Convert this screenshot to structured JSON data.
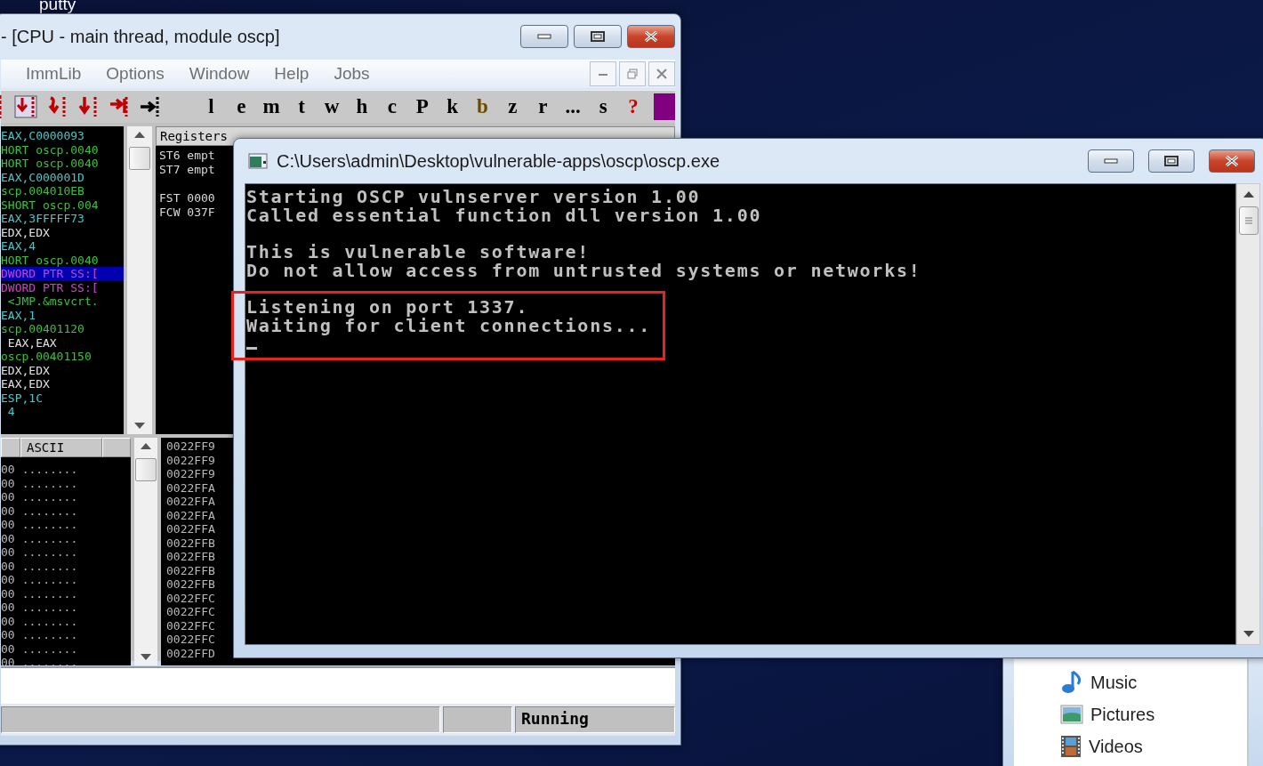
{
  "desktop": {
    "icon_label": "putty"
  },
  "debugger": {
    "title": "- [CPU - main thread, module oscp]",
    "menu": [
      "ImmLib",
      "Options",
      "Window",
      "Help",
      "Jobs"
    ],
    "toolbar": [
      {
        "label": "l",
        "color": "#000000"
      },
      {
        "label": "e",
        "color": "#000000"
      },
      {
        "label": "m",
        "color": "#000000"
      },
      {
        "label": "t",
        "color": "#000000"
      },
      {
        "label": "w",
        "color": "#000000"
      },
      {
        "label": "h",
        "color": "#000000"
      },
      {
        "label": "c",
        "color": "#000000"
      },
      {
        "label": "P",
        "color": "#000000"
      },
      {
        "label": "k",
        "color": "#000000"
      },
      {
        "label": "b",
        "color": "#6b4a00"
      },
      {
        "label": "z",
        "color": "#000000"
      },
      {
        "label": "r",
        "color": "#000000"
      },
      {
        "label": "...",
        "color": "#000000"
      },
      {
        "label": "s",
        "color": "#000000"
      },
      {
        "label": "?",
        "color": "#cc0000"
      }
    ],
    "disassembly": [
      {
        "text": "EAX,C0000093",
        "kind": "value",
        "selected": false
      },
      {
        "text": "HORT oscp.0040",
        "kind": "jump",
        "selected": false
      },
      {
        "text": "HORT oscp.0040",
        "kind": "jump",
        "selected": false
      },
      {
        "text": "EAX,C000001D",
        "kind": "value",
        "selected": false
      },
      {
        "text": "scp.004010EB",
        "kind": "jump",
        "selected": false
      },
      {
        "text": "SHORT oscp.004",
        "kind": "jump",
        "selected": false
      },
      {
        "text": "EAX,3FFFFF73",
        "kind": "value",
        "selected": false
      },
      {
        "text": "EDX,EDX",
        "kind": "register",
        "selected": false
      },
      {
        "text": "EAX,4",
        "kind": "value",
        "selected": false
      },
      {
        "text": "HORT oscp.0040",
        "kind": "jump",
        "selected": false
      },
      {
        "text": "DWORD PTR SS:[",
        "kind": "pointer",
        "selected": true
      },
      {
        "text": "DWORD PTR SS:[",
        "kind": "pointer",
        "selected": false
      },
      {
        "text": " <JMP.&msvcrt.",
        "kind": "jump",
        "selected": false
      },
      {
        "text": "EAX,1",
        "kind": "value",
        "selected": false
      },
      {
        "text": "scp.00401120",
        "kind": "jump",
        "selected": false
      },
      {
        "text": " EAX,EAX",
        "kind": "register",
        "selected": false
      },
      {
        "text": "oscp.00401150",
        "kind": "jump",
        "selected": false
      },
      {
        "text": "EDX,EDX",
        "kind": "register",
        "selected": false
      },
      {
        "text": "EAX,EDX",
        "kind": "register",
        "selected": false
      },
      {
        "text": "ESP,1C",
        "kind": "value",
        "selected": false
      },
      {
        "text": " 4",
        "kind": "value",
        "selected": false
      }
    ],
    "registers": {
      "header": "Registers",
      "groups": [
        [
          "ST6 empt",
          "ST7 empt"
        ],
        [
          "FST 0000",
          "FCW 037F"
        ]
      ]
    },
    "dump": {
      "column_header": "ASCII",
      "rows": [
        {
          "hex": "00",
          "ascii": "........"
        },
        {
          "hex": "00",
          "ascii": "........"
        },
        {
          "hex": "00",
          "ascii": "........"
        },
        {
          "hex": "00",
          "ascii": "........"
        },
        {
          "hex": "00",
          "ascii": "........"
        },
        {
          "hex": "00",
          "ascii": "........"
        },
        {
          "hex": "00",
          "ascii": "........"
        },
        {
          "hex": "00",
          "ascii": "........"
        },
        {
          "hex": "00",
          "ascii": "........"
        },
        {
          "hex": "00",
          "ascii": "........"
        },
        {
          "hex": "00",
          "ascii": "........"
        },
        {
          "hex": "00",
          "ascii": "........"
        },
        {
          "hex": "00",
          "ascii": "........"
        },
        {
          "hex": "00",
          "ascii": "........"
        },
        {
          "hex": "00",
          "ascii": "........"
        }
      ]
    },
    "stack": [
      "0022FF9",
      "0022FF9",
      "0022FF9",
      "0022FFA",
      "0022FFA",
      "0022FFA",
      "0022FFA",
      "0022FFB",
      "0022FFB",
      "0022FFB",
      "0022FFB",
      "0022FFC",
      "0022FFC",
      "0022FFC",
      "0022FFC",
      "0022FFD"
    ],
    "status": "Running"
  },
  "console": {
    "title": "C:\\Users\\admin\\Desktop\\vulnerable-apps\\oscp\\oscp.exe",
    "paragraphs": [
      {
        "lines": [
          "Starting OSCP vulnserver version 1.00",
          "Called essential function dll version 1.00"
        ],
        "highlighted": false,
        "cursor": false
      },
      {
        "lines": [
          "This is vulnerable software!",
          "Do not allow access from untrusted systems or networks!"
        ],
        "highlighted": false,
        "cursor": false
      },
      {
        "lines": [
          "Listening on port 1337.",
          "Waiting for client connections..."
        ],
        "highlighted": true,
        "cursor": true
      }
    ]
  },
  "explorer": {
    "items": [
      {
        "label": "Music",
        "kind": "music"
      },
      {
        "label": "Pictures",
        "kind": "pictures"
      },
      {
        "label": "Videos",
        "kind": "videos"
      }
    ]
  }
}
